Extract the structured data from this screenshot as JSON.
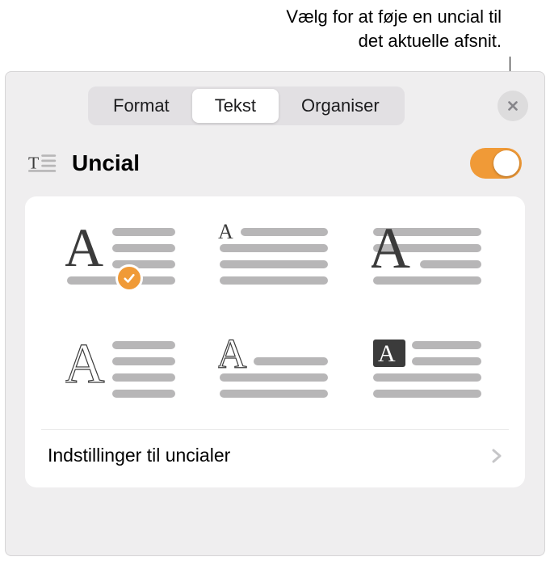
{
  "callout": {
    "line1": "Vælg for at føje en uncial til",
    "line2": "det aktuelle afsnit."
  },
  "tabs": {
    "format": "Format",
    "text": "Tekst",
    "organize": "Organiser"
  },
  "section": {
    "title": "Uncial"
  },
  "settings": {
    "label": "Indstillinger til uncialer"
  },
  "colors": {
    "accent": "#f09a37",
    "line": "#b7b6b7",
    "letter": "#3b3b3b"
  }
}
